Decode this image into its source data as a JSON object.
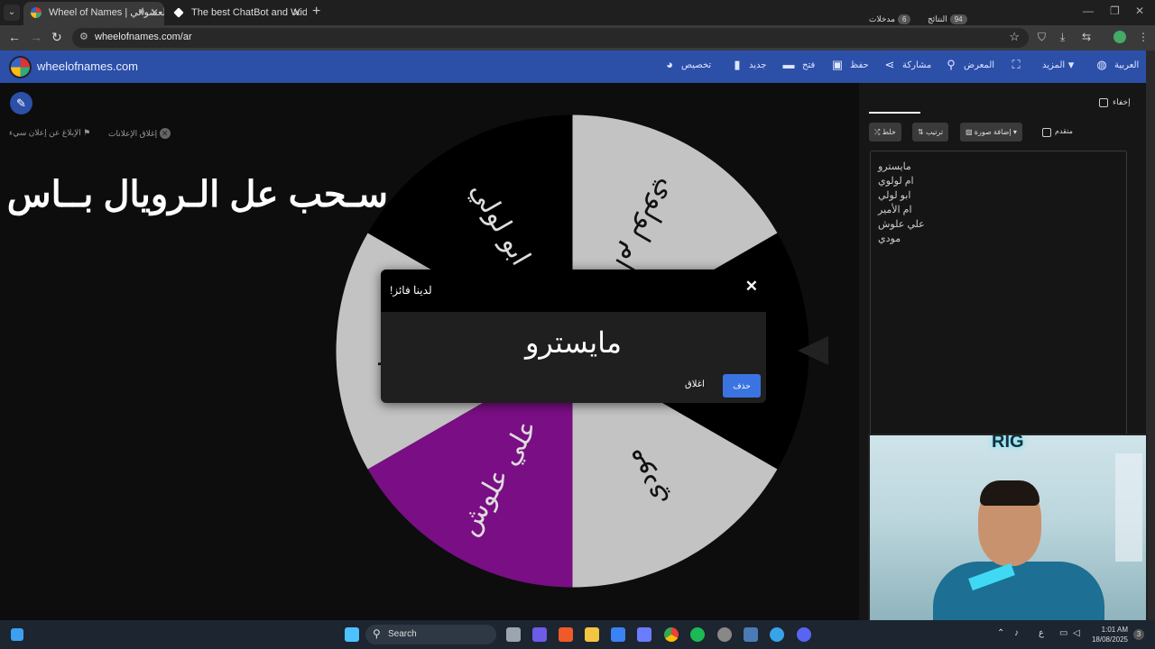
{
  "browser": {
    "tabs": [
      {
        "title": "Wheel of Names | العشوائي",
        "active": true
      },
      {
        "title": "The best ChatBot and Widgets",
        "active": false
      }
    ],
    "url": "wheelofnames.com/ar"
  },
  "app": {
    "logo_text": "wheelofnames.com",
    "menu": {
      "customize": "تخصيص",
      "new": "جديد",
      "open": "فتح",
      "save": "حفظ",
      "share": "مشاركة",
      "gallery": "المعرض",
      "more": "المزيد",
      "language": "العربية"
    },
    "close_ads": "إغلاق الإعلانات",
    "report_ad": "الإبلاغ عن إعلان سيء",
    "promo_text": "سـحب عل الـرويال بــاس"
  },
  "wheel": {
    "segments": [
      "مايسترو",
      "ام لولوي",
      "ابو لولي",
      "ام الأمير",
      "علي علوش",
      "مودي"
    ],
    "colors": {
      "purple": "#7a0e84",
      "gray": "#c3c3c3",
      "black": "#000000"
    }
  },
  "modal": {
    "title": "لدينا فائز!",
    "winner": "مايسترو",
    "delete_label": "حذف",
    "close_label": "اغلاق"
  },
  "side": {
    "tab_entries": "مدخلات",
    "entries_count": "6",
    "tab_results": "النتائج",
    "results_count": "94",
    "hide_label": "إخفاء",
    "shuffle_label": "خلط",
    "sort_label": "ترتيب",
    "add_image_label": "إضافة صورة",
    "advanced_label": "متقدم",
    "entries": [
      "مايسترو",
      "ام لولوي",
      "ابو لولي",
      "ام الأمير",
      "علي علوش",
      "مودي"
    ]
  },
  "webcam": {
    "logo": "RIG"
  },
  "taskbar": {
    "search_placeholder": "Search",
    "time": "1:01 AM",
    "date": "18/08/2025",
    "lang": "ع",
    "notif_count": "3"
  }
}
